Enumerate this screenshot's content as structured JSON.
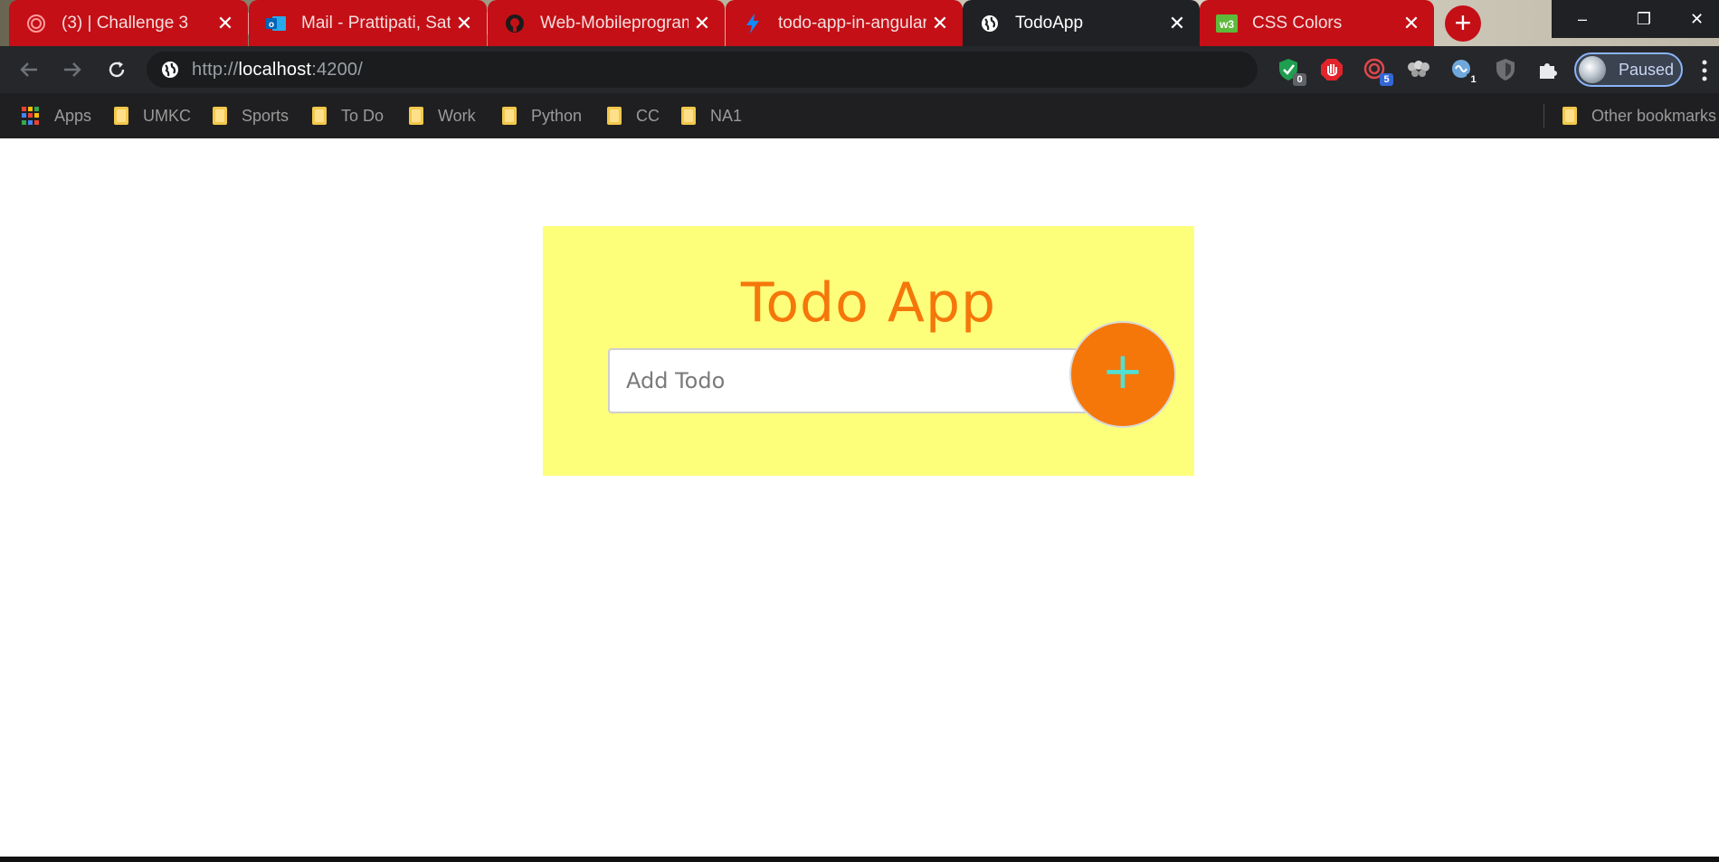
{
  "browser": {
    "tabs": [
      {
        "label": "(3) | Challenge 3",
        "icon": "spiral-logo-icon",
        "active": false
      },
      {
        "label": "Mail - Prattipati, Satya",
        "icon": "outlook-icon",
        "active": false
      },
      {
        "label": "Web-Mobileprogramming",
        "icon": "github-icon",
        "active": false
      },
      {
        "label": "todo-app-in-angular",
        "icon": "lightning-icon",
        "active": false
      },
      {
        "label": "TodoApp",
        "icon": "globe-icon",
        "active": true
      },
      {
        "label": "CSS Colors",
        "icon": "w3-icon",
        "active": false
      }
    ],
    "new_tab": "+",
    "window_controls": {
      "minimize": "–",
      "restore": "❐",
      "close": "✕"
    },
    "address": {
      "scheme": "http://",
      "host": "localhost",
      "rest": ":4200/"
    },
    "extensions": [
      {
        "name": "shield-check-extension-icon",
        "badge": "0",
        "badge_color": "#5f6368"
      },
      {
        "name": "adblock-hand-extension-icon",
        "badge": "",
        "badge_color": ""
      },
      {
        "name": "spiral-extension-icon",
        "badge": "5",
        "badge_color": "#3367d6"
      },
      {
        "name": "tampermonkey-extension-icon",
        "badge": "",
        "badge_color": ""
      },
      {
        "name": "brain-extension-icon",
        "badge": "1",
        "badge_color": "#26272a"
      },
      {
        "name": "shield-extension-icon",
        "badge": "",
        "badge_color": ""
      },
      {
        "name": "puzzle-extensions-icon",
        "badge": "",
        "badge_color": ""
      }
    ],
    "profile_label": "Paused",
    "bookmarks": [
      "Apps",
      "UMKC",
      "Sports",
      "To Do",
      "Work",
      "Python",
      "CC",
      "NA1"
    ],
    "other_bookmarks": "Other bookmarks",
    "colors": {
      "tab_red": "#c40f16",
      "toolbar": "#26272a",
      "bookmarks_bar": "#1f1f21"
    }
  },
  "app": {
    "title": "Todo App",
    "input_placeholder": "Add Todo",
    "input_value": "",
    "add_button_label": "+",
    "colors": {
      "card": "#fdff7b",
      "accent": "#f5770a",
      "plus": "#4fe0d4"
    }
  }
}
